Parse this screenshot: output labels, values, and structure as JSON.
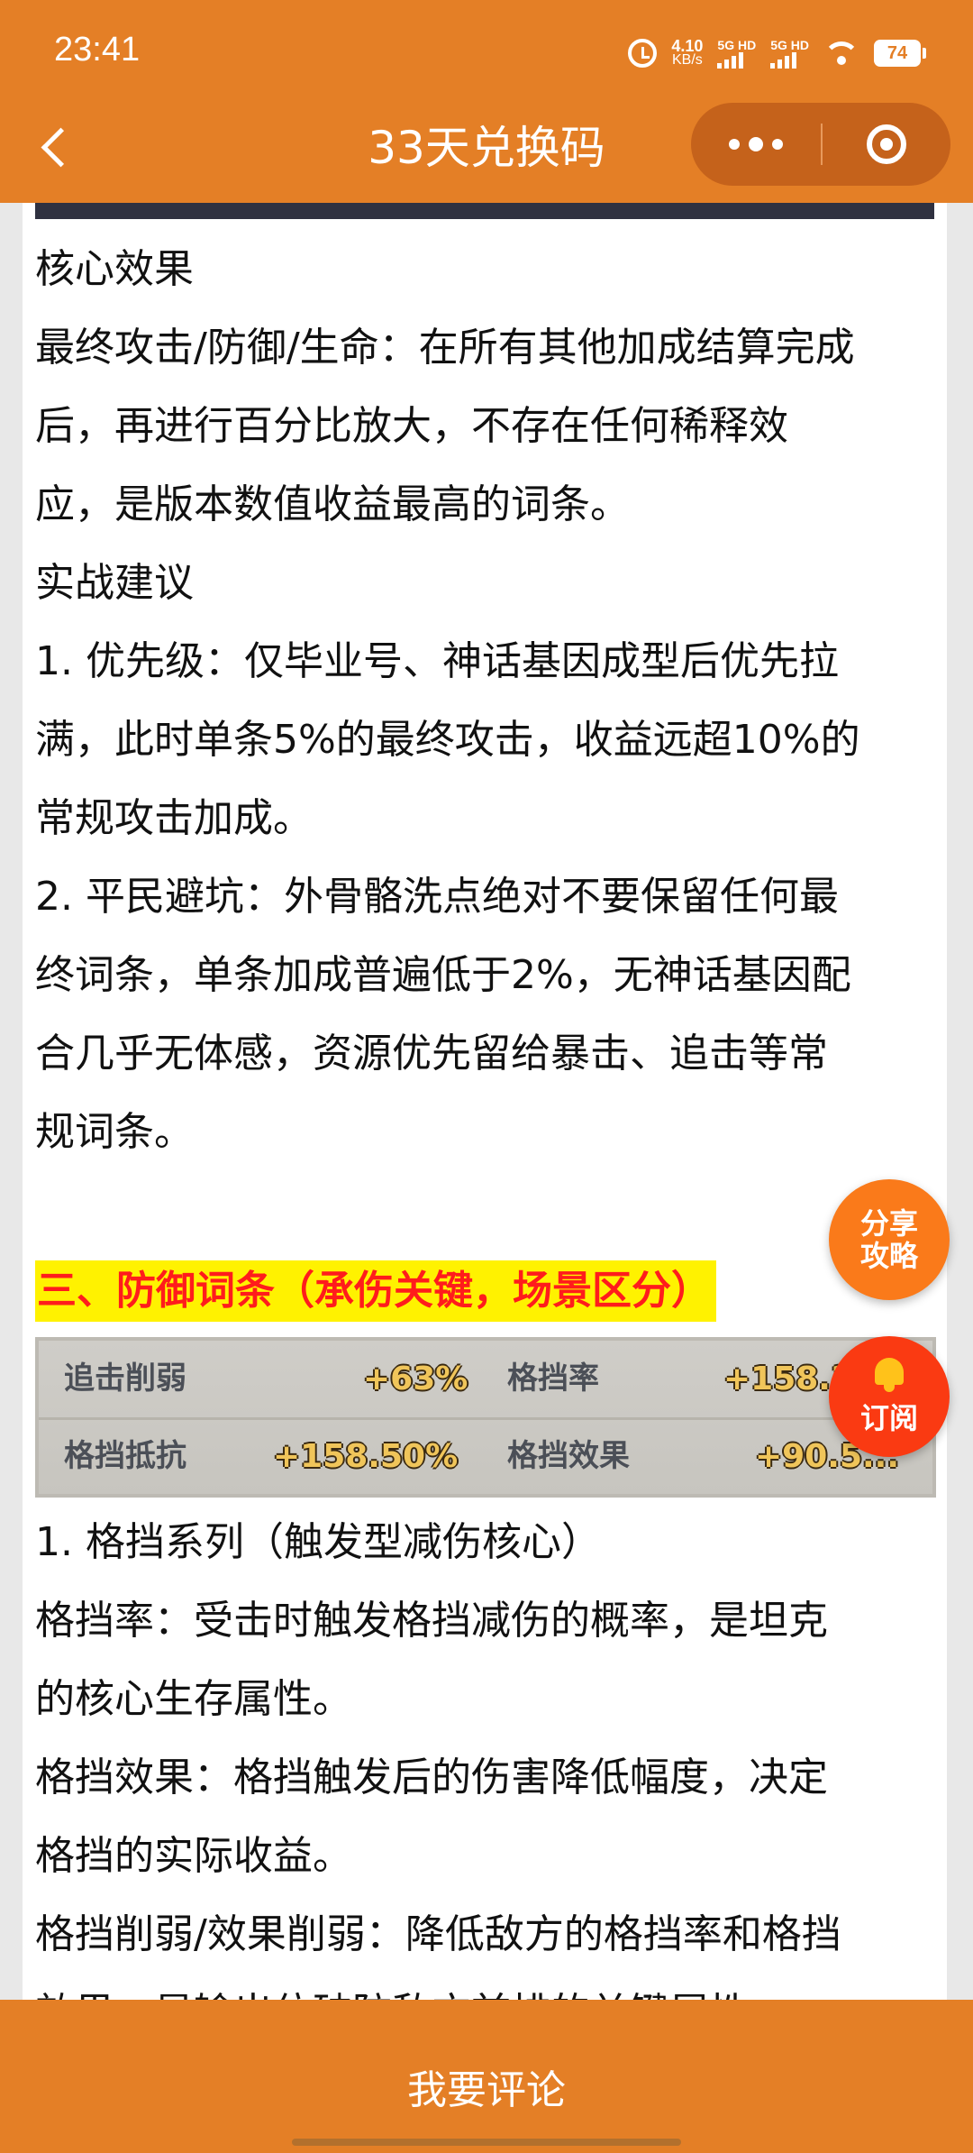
{
  "status_bar": {
    "time": "23:41",
    "net_speed_value": "4.10",
    "net_speed_unit": "KB/s",
    "sim1": "5G HD",
    "sim2": "5G HD",
    "battery": "74",
    "icons": [
      "alarm-icon",
      "signal-icon",
      "wifi-icon",
      "battery-icon"
    ]
  },
  "header": {
    "title": "33天兑换码",
    "back_icon": "chevron-left-icon",
    "more_icon": "more-dots-icon",
    "close_icon": "record-close-icon"
  },
  "article": {
    "paragraphs_top": [
      "核心效果",
      "最终攻击/防御/生命：在所有其他加成结算完成",
      "后，再进行百分比放大，不存在任何稀释效",
      "应，是版本数值收益最高的词条。",
      "实战建议",
      "1. 优先级：仅毕业号、神话基因成型后优先拉",
      "满，此时单条5%的最终攻击，收益远超10%的",
      "常规攻击加成。",
      "2. 平民避坑：外骨骼洗点绝对不要保留任何最",
      "终词条，单条加成普遍低于2%，无神话基因配",
      "合几乎无体感，资源优先留给暴击、追击等常",
      "规词条。"
    ],
    "section_title": "三、防御词条（承伤关键，场景区分）",
    "attr_table": {
      "rows": [
        [
          {
            "label": "追击削弱",
            "value": "+63%"
          },
          {
            "label": "格挡率",
            "value": "+158.3..."
          }
        ],
        [
          {
            "label": "格挡抵抗",
            "value": "+158.50%"
          },
          {
            "label": "格挡效果",
            "value": "+90.5..."
          }
        ]
      ]
    },
    "paragraphs_bottom": [
      "1. 格挡系列（触发型减伤核心）",
      "格挡率：受击时触发格挡减伤的概率，是坦克",
      "的核心生存属性。",
      "格挡效果：格挡触发后的伤害降低幅度，决定",
      "格挡的实际收益。",
      "格挡削弱/效果削弱：降低敌方的格挡率和格挡",
      "效果，是输出位破防敌方前排的关键属性。"
    ]
  },
  "floating": {
    "share_line1": "分享",
    "share_line2": "攻略",
    "subscribe": "订阅"
  },
  "bottom_bar": {
    "comment_label": "我要评论"
  },
  "colors": {
    "brand_orange": "#e47f26",
    "section_highlight": "#fff200",
    "section_text": "#ff1c1c"
  }
}
